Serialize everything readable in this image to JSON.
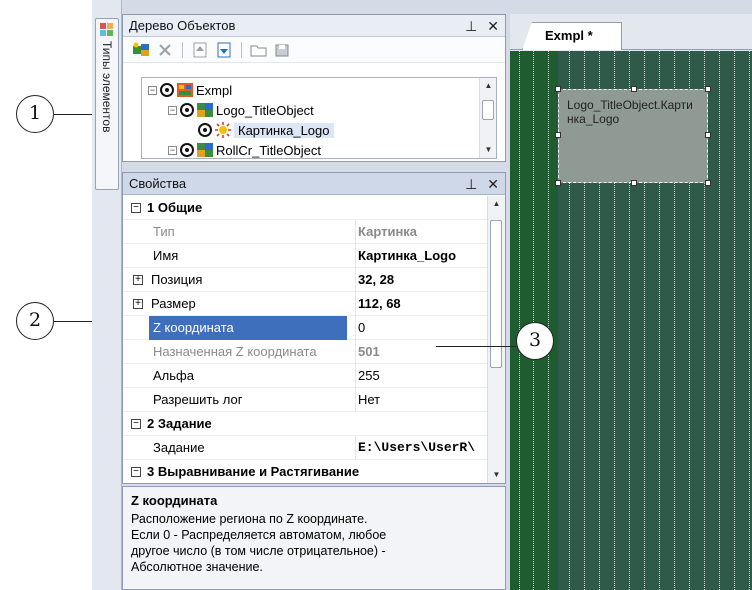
{
  "side_tab": {
    "label": "Типы элементов"
  },
  "tree_panel": {
    "title": "Дерево Объектов",
    "pin": "⊥",
    "close": "✕",
    "items": [
      {
        "label": "Exmpl"
      },
      {
        "label": "Logo_TitleObject"
      },
      {
        "label": "Картинка_Logo"
      },
      {
        "label": "RollCr_TitleObject"
      }
    ]
  },
  "props_panel": {
    "title": "Свойства",
    "pin": "⊥",
    "close": "✕",
    "rows": [
      {
        "name": "1 Общие",
        "value": ""
      },
      {
        "name": "Тип",
        "value": "Картинка"
      },
      {
        "name": "Имя",
        "value": "Картинка_Logo"
      },
      {
        "name": "Позиция",
        "value": "32, 28"
      },
      {
        "name": "Размер",
        "value": "112, 68"
      },
      {
        "name": "Z координата",
        "value": "0"
      },
      {
        "name": "Назначенная Z координата",
        "value": "501"
      },
      {
        "name": "Альфа",
        "value": "255"
      },
      {
        "name": "Разрешить лог",
        "value": "Нет"
      },
      {
        "name": "2 Задание",
        "value": ""
      },
      {
        "name": "Задание",
        "value": "E:\\Users\\UserR\\"
      },
      {
        "name": "3 Выравнивание и Растягивание",
        "value": ""
      }
    ]
  },
  "description": {
    "title": "Z координата",
    "lines": [
      "Расположение региона по Z координате.",
      " Если 0 - Распределяется автоматом, любое",
      "другое число (в том числе отрицательное) -",
      "Абсолютное значение."
    ]
  },
  "editor": {
    "tab_label": "Exmpl *",
    "region_label": "Logo_TitleObject.Картинка_Logo"
  },
  "callouts": {
    "c1": "1",
    "c2": "2",
    "c3": "3"
  },
  "colors": {
    "canvas": "#1f5c2f",
    "selection": "#3e6fbd"
  }
}
